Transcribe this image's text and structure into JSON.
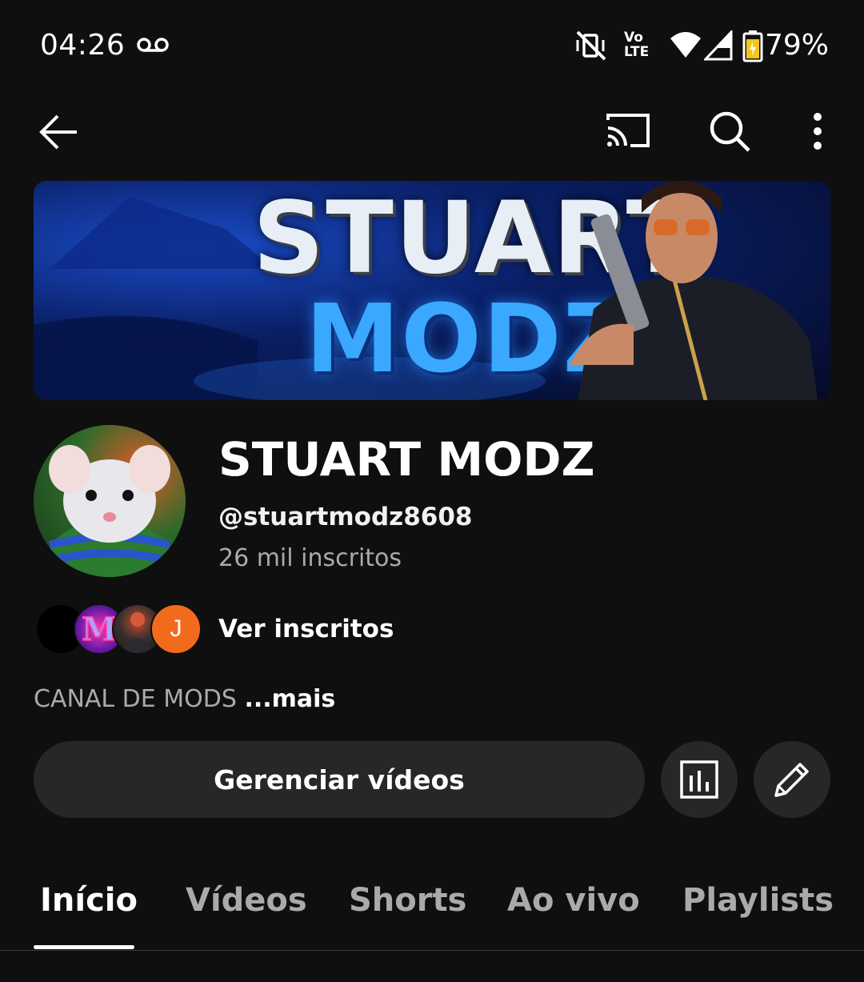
{
  "status_bar": {
    "time": "04:26",
    "battery": "79%",
    "volte_line1": "Vo",
    "volte_line2": "LTE"
  },
  "banner": {
    "line1": "STUART",
    "line2": "MODZ"
  },
  "channel": {
    "name": "STUART MODZ",
    "handle": "@stuartmodz8608",
    "subscribers": "26 mil inscritos"
  },
  "subscribers_preview": {
    "label": "Ver inscritos",
    "avatar_initial": "J"
  },
  "description": {
    "text": "CANAL DE MODS ",
    "more": "...mais"
  },
  "actions": {
    "manage_videos": "Gerenciar vídeos",
    "analytics_icon": "bar-chart-icon",
    "edit_icon": "pencil-icon"
  },
  "tabs": [
    {
      "label": "Início",
      "active": true
    },
    {
      "label": "Vídeos",
      "active": false
    },
    {
      "label": "Shorts",
      "active": false
    },
    {
      "label": "Ao vivo",
      "active": false
    },
    {
      "label": "Playlists",
      "active": false
    }
  ],
  "colors": {
    "background": "#0f0f0f",
    "button_bg": "#272727",
    "secondary_text": "#aaaaaa",
    "avatar_orange": "#f26b1d",
    "battery_yellow": "#f5c518"
  }
}
